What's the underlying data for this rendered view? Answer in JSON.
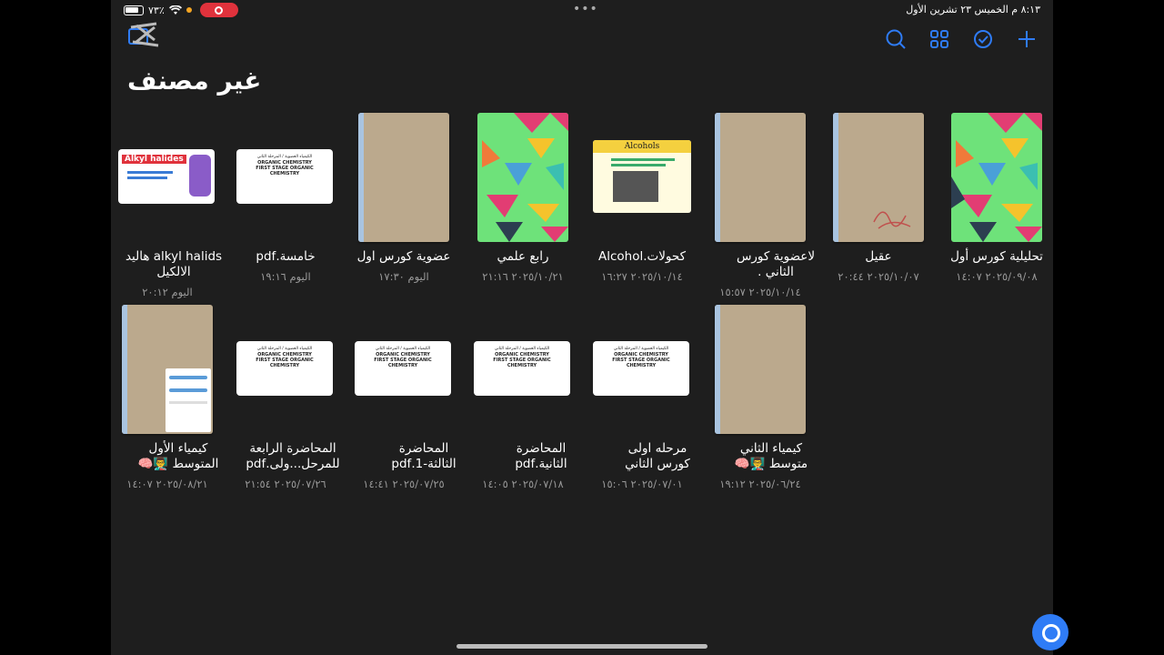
{
  "status_bar": {
    "time_text": "٨:١٣ م  الخميس ٢٣ تشرين الأول",
    "battery_text": "٧٣٪",
    "dots": "•••"
  },
  "toolbar": {
    "icons": [
      "add-icon",
      "select-icon",
      "grid-view-icon",
      "search-icon"
    ],
    "accent": "#2f7cf6"
  },
  "page_title": "غير مصنف",
  "documents": [
    {
      "name": "تحليلية كورس أول",
      "date": "٢٠٢٥/٠٩/٠٨ ١٤:٠٧"
    },
    {
      "name": "عقيل",
      "date": "٢٠٢٥/١٠/٠٧ ٢٠:٤٤"
    },
    {
      "name": "لاعضوية كورس الثاني .",
      "date": "٢٠٢٥/١٠/١٤ ١٥:٥٧"
    },
    {
      "name": "كحولات.Alcohol",
      "date": "٢٠٢٥/١٠/١٤ ١٦:٢٧"
    },
    {
      "name": "رابع علمي",
      "date": "٢٠٢٥/١٠/٢١ ٢١:١٦"
    },
    {
      "name": "عضوية كورس اول",
      "date": "اليوم ١٧:٣٠"
    },
    {
      "name": "خامسة.pdf",
      "date": "اليوم ١٩:١٦"
    },
    {
      "name": "alkyl halids هاليد الالكيل",
      "date": "اليوم ٢٠:١٢"
    },
    {
      "name": "كيمياء الثاني متوسط 👨‍🏫🧠",
      "date": "٢٠٢٥/٠٦/٢٤ ١٩:١٢"
    },
    {
      "name": "مرحله اولى كورس الثاني",
      "date": "٢٠٢٥/٠٧/٠١ ١٥:٠٦"
    },
    {
      "name": "المحاضرة الثانية.pdf",
      "date": "٢٠٢٥/٠٧/١٨ ١٤:٠٥"
    },
    {
      "name": "المحاضرة الثالثة-1.pdf",
      "date": "٢٠٢٥/٠٧/٢٥ ١٤:٤١"
    },
    {
      "name": "المحاضرة الرابعة للمرحل...ولى.pdf",
      "date": "٢٠٢٥/٠٧/٢٦ ٢١:٥٤"
    },
    {
      "name": "كيمياء الأول المتوسط 👨‍🏫🧠",
      "date": "٢٠٢٥/٠٨/٢١ ١٤:٠٧"
    }
  ],
  "thumb_text": {
    "alcohols": "Alcohols",
    "alkyl": "Alkyl halides",
    "doc_header": "الكيمياء العضوية / المرحلة الثاني",
    "organic": "ORGANIC CHEMISTRY",
    "first_stage": "FIRST STAGE ORGANIC CHEMISTRY"
  },
  "colors": {
    "background": "#1e1e1e",
    "notebook": "#bba98d",
    "pattern_green": "#6ee27a",
    "record": "#e0323c"
  }
}
